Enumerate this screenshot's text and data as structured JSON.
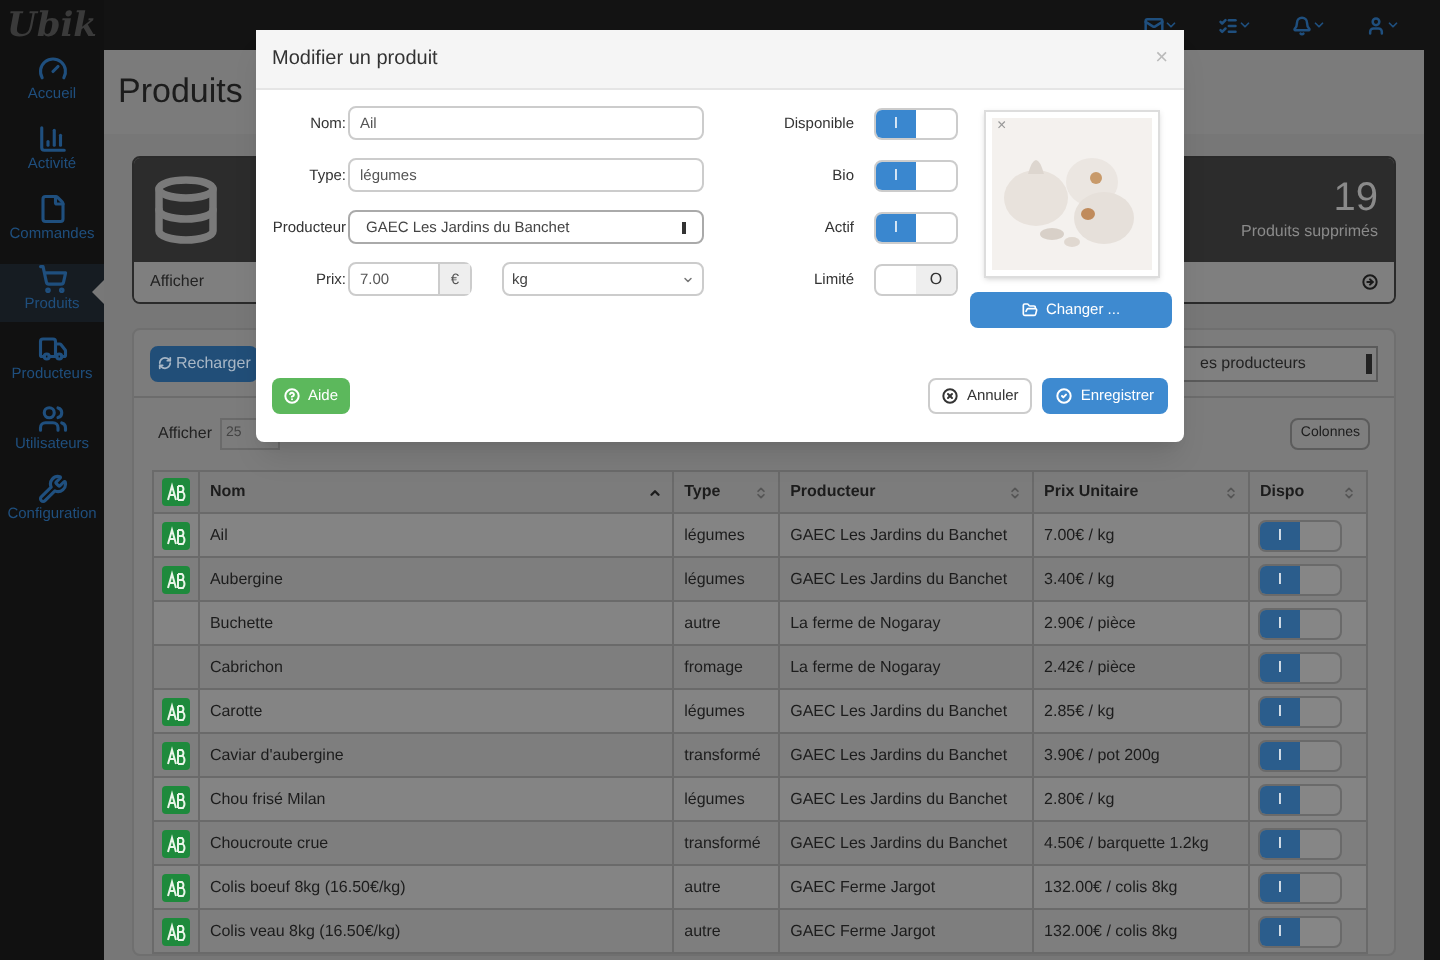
{
  "sidebar": {
    "logo": "Ubik",
    "items": [
      {
        "label": "Accueil",
        "selected": false
      },
      {
        "label": "Activité",
        "selected": false
      },
      {
        "label": "Commandes",
        "selected": false
      },
      {
        "label": "Produits",
        "selected": true
      },
      {
        "label": "Producteurs",
        "selected": false
      },
      {
        "label": "Utilisateurs",
        "selected": false
      },
      {
        "label": "Configuration",
        "selected": false
      }
    ]
  },
  "page": {
    "title": "Produits"
  },
  "stats": {
    "value": "19",
    "label": "Produits supprimés",
    "link": "Afficher"
  },
  "toolbar": {
    "reload": "Recharger",
    "producer_filter": "es producteurs"
  },
  "table_controls": {
    "show_label": "Afficher",
    "page_length": "25",
    "columns_button": "Colonnes"
  },
  "table": {
    "columns": [
      {
        "label": "Nom",
        "sorted": true
      },
      {
        "label": "Type",
        "sorted": false
      },
      {
        "label": "Producteur",
        "sorted": false
      },
      {
        "label": "Prix Unitaire",
        "sorted": false
      },
      {
        "label": "Dispo",
        "sorted": false
      }
    ],
    "rows": [
      {
        "bio": true,
        "name": "Ail",
        "type": "légumes",
        "producer": "GAEC Les Jardins du Banchet",
        "price": "7.00€ / kg",
        "dispo": {
          "on": true,
          "text": "I"
        }
      },
      {
        "bio": true,
        "name": "Aubergine",
        "type": "légumes",
        "producer": "GAEC Les Jardins du Banchet",
        "price": "3.40€ / kg",
        "dispo": {
          "on": true,
          "text": "I"
        }
      },
      {
        "bio": false,
        "name": "Buchette",
        "type": "autre",
        "producer": "La ferme de Nogaray",
        "price": "2.90€ / pièce",
        "dispo": {
          "on": true,
          "text": "I"
        }
      },
      {
        "bio": false,
        "name": "Cabrichon",
        "type": "fromage",
        "producer": "La ferme de Nogaray",
        "price": "2.42€ / pièce",
        "dispo": {
          "on": true,
          "text": "I"
        }
      },
      {
        "bio": true,
        "name": "Carotte",
        "type": "légumes",
        "producer": "GAEC Les Jardins du Banchet",
        "price": "2.85€ / kg",
        "dispo": {
          "on": true,
          "text": "I"
        }
      },
      {
        "bio": true,
        "name": "Caviar d'aubergine",
        "type": "transformé",
        "producer": "GAEC Les Jardins du Banchet",
        "price": "3.90€ / pot 200g",
        "dispo": {
          "on": true,
          "text": "I"
        }
      },
      {
        "bio": true,
        "name": "Chou frisé Milan",
        "type": "légumes",
        "producer": "GAEC Les Jardins du Banchet",
        "price": "2.80€ / kg",
        "dispo": {
          "on": true,
          "text": "I"
        }
      },
      {
        "bio": true,
        "name": "Choucroute crue",
        "type": "transformé",
        "producer": "GAEC Les Jardins du Banchet",
        "price": "4.50€ / barquette 1.2kg",
        "dispo": {
          "on": true,
          "text": "I"
        }
      },
      {
        "bio": true,
        "name": "Colis boeuf 8kg (16.50€/kg)",
        "type": "autre",
        "producer": "GAEC Ferme Jargot",
        "price": "132.00€ / colis 8kg",
        "dispo": {
          "on": true,
          "text": "I"
        }
      },
      {
        "bio": true,
        "name": "Colis veau 8kg (16.50€/kg)",
        "type": "autre",
        "producer": "GAEC Ferme Jargot",
        "price": "132.00€ / colis 8kg",
        "dispo": {
          "on": true,
          "text": "I"
        }
      }
    ]
  },
  "dialog": {
    "title": "Modifier un produit",
    "close": "×",
    "fields": [
      {
        "kind": "text",
        "label": "Nom:",
        "value": "Ail"
      },
      {
        "kind": "text",
        "label": "Type:",
        "value": "légumes"
      },
      {
        "kind": "select",
        "label": "Producteur",
        "value": "GAEC Les Jardins du Banchet"
      },
      {
        "kind": "price",
        "label": "Prix:",
        "value": "7.00",
        "addon": "€",
        "unit": "kg"
      }
    ],
    "toggles": [
      {
        "label": "Disponible",
        "on": true,
        "text": "I"
      },
      {
        "label": "Bio",
        "on": true,
        "text": "I"
      },
      {
        "label": "Actif",
        "on": true,
        "text": "I"
      },
      {
        "label": "Limité",
        "on": false,
        "text": "O"
      }
    ],
    "image_remove": "×",
    "change_button": "Changer ...",
    "help_button": "Aide",
    "cancel_button": "Annuler",
    "save_button": "Enregistrer"
  }
}
